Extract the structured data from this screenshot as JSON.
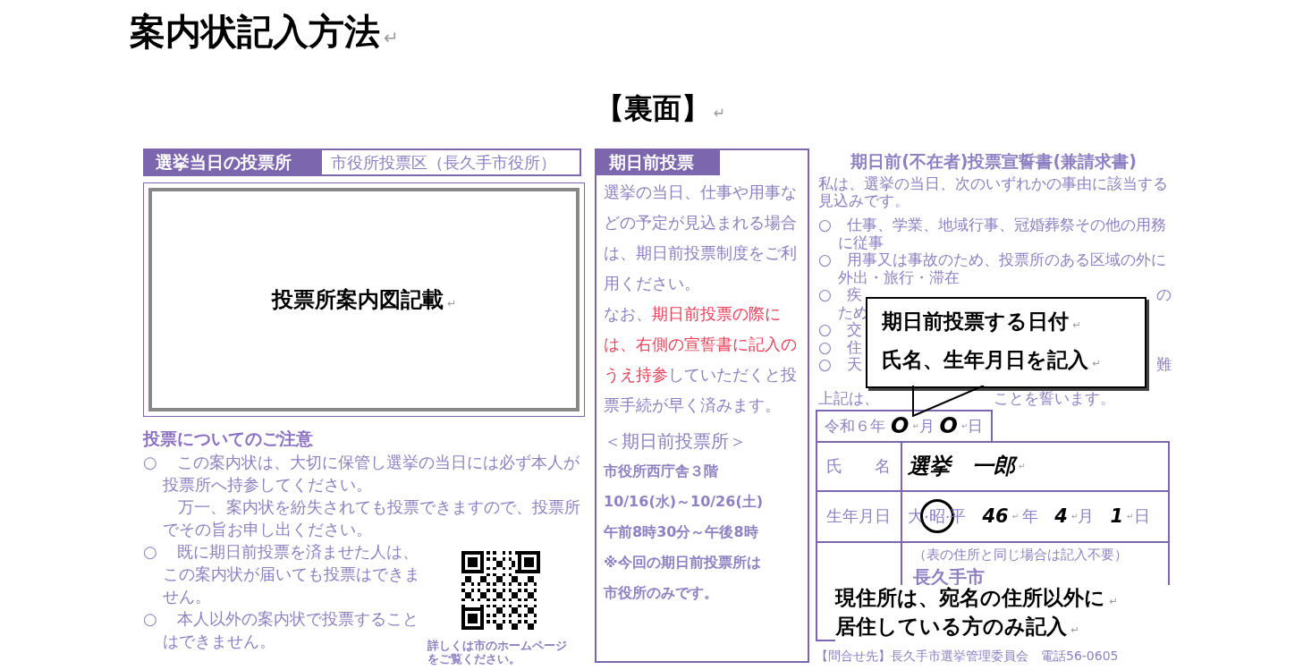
{
  "title": {
    "text": "案内状記入方法",
    "end_mark": "↵"
  },
  "subtitle": {
    "text": "【裏面】",
    "end_mark": "↵"
  },
  "polling_place": {
    "heading": "選挙当日の投票所",
    "district": "市役所投票区（長久手市役所）",
    "map_label": "投票所案内図記載",
    "end_mark": "↵"
  },
  "notes": {
    "heading": "投票についてのご注意",
    "items": [
      {
        "bullet": "○",
        "paragraphs": [
          "この案内状は、大切に保管し選挙の当日には必ず本人が投票所へ持参してください。",
          "万一、案内状を紛失されても投票できますので、投票所でその旨お申し出ください。"
        ]
      },
      {
        "bullet": "○",
        "paragraphs": [
          "既に期日前投票を済ませた人は、この案内状が届いても投票はできません。"
        ]
      },
      {
        "bullet": "○",
        "paragraphs": [
          "本人以外の案内状で投票することはできません。"
        ]
      }
    ],
    "qr_caption": "詳しくは市のホームページをご覧ください。"
  },
  "early_voting": {
    "heading": "期日前投票",
    "body": [
      [
        {
          "text": "選挙の当日、仕事や用事などの予定が見込まれる場合は、期日前投票制度をご利用ください。",
          "emphasis": false
        }
      ],
      [
        {
          "text": "なお、",
          "emphasis": false
        },
        {
          "text": "期日前投票の際には、右側の宣誓書に記入のうえ持参",
          "emphasis": true
        },
        {
          "text": "していただくと投票手続が早く済みます。",
          "emphasis": false
        }
      ]
    ],
    "place_heading": "＜期日前投票所＞",
    "details": [
      "市役所西庁舎３階",
      "10/16(水)～10/26(土)",
      "午前8時30分～午後8時",
      "※今回の期日前投票所は市役所のみです。"
    ]
  },
  "declaration": {
    "title": "期日前(不在者)投票宣誓書(兼請求書)",
    "intro": "私は、選挙の当日、次のいずれかの事由に該当する見込みです。",
    "reasons": [
      {
        "bullet": "○",
        "text": "仕事、学業、地域行事、冠婚葬祭その他の用務に従事"
      },
      {
        "bullet": "○",
        "text": "用事又は事故のため、投票所のある区域の外に外出・旅行・滞在"
      },
      {
        "bullet": "○",
        "text": "疾",
        "tail": "の",
        "next_line": "ため"
      },
      {
        "bullet": "○",
        "text": "交"
      },
      {
        "bullet": "○",
        "text": "住"
      },
      {
        "bullet": "○",
        "text": "天",
        "tail": "難"
      }
    ],
    "pledge": {
      "text": "上記は、",
      "tail": "ことを誓います。"
    },
    "date": {
      "era_year": "令和６年",
      "month": "O",
      "month_mark": "↵",
      "month_label": "月",
      "day": "O",
      "day_mark": "↵",
      "day_label": "日"
    },
    "name_row": {
      "label": "氏　　名",
      "value": "選挙　一郎",
      "end_mark": "↵"
    },
    "birth_row": {
      "label": "生年月日",
      "eras": [
        {
          "label": "大",
          "selected": false
        },
        {
          "label": "昭",
          "selected": true
        },
        {
          "label": "平",
          "selected": false
        }
      ],
      "separators": [
        "·",
        "·"
      ],
      "year": "46",
      "year_mark": "↵",
      "year_label": "年",
      "month": "4",
      "month_mark": "↵",
      "month_label": "月",
      "day": "1",
      "day_mark": "↵",
      "day_label": "日"
    },
    "address_row": {
      "hint": "（表の住所と同じ場合は記入不要）",
      "value": "長久手市"
    },
    "contact": "【問合せ先】長久手市選挙管理委員会　電話56-0605"
  },
  "callouts": [
    {
      "kind": "speech",
      "lines": [
        {
          "text": "期日前投票する日付",
          "end_mark": "↵"
        },
        {
          "text": "氏名、生年月日を記入",
          "end_mark": "↵"
        }
      ]
    },
    {
      "kind": "plain",
      "lines": [
        {
          "text": "現住所は、宛名の住所以外に",
          "end_mark": "↵"
        },
        {
          "text": "居住している方のみ記入",
          "end_mark": "↵"
        }
      ]
    }
  ]
}
